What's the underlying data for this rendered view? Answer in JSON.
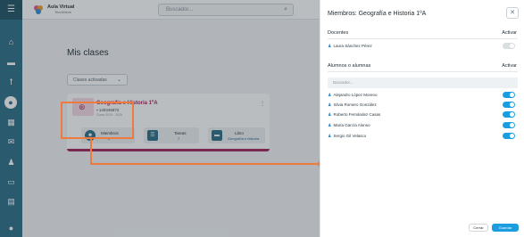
{
  "app": {
    "brand": "Aula Virtual",
    "brand_sub": "TecniMeve"
  },
  "topbar": {
    "search_placeholder": "Buscador...",
    "search_icon": "search-icon"
  },
  "nav": {
    "icons": [
      "menu-icon",
      "home-icon",
      "book-icon",
      "translate-icon",
      "user-circle-icon",
      "calendar-icon",
      "mail-icon",
      "person-icon",
      "folder-icon",
      "document-icon",
      "info-icon"
    ]
  },
  "main": {
    "title": "Mis clases",
    "filter": "Clases activadas",
    "card": {
      "title": "Geografía e Historia 1ºA",
      "code": "140345872",
      "dates": "Curso 2024 · 2025",
      "tiles": [
        {
          "label": "Miembros",
          "value": "6"
        },
        {
          "label": "Tareas",
          "value": "7"
        },
        {
          "label": "Libro",
          "value": "Geografía e historia"
        }
      ]
    }
  },
  "panel": {
    "title": "Miembros: Geografía e Historia 1ºA",
    "docentes_heading": "Docentes",
    "activar_label": "Activar",
    "teachers": [
      {
        "name": "Laura Sánchez Pérez",
        "active": false
      }
    ],
    "alumnos_heading": "Alumnos o alumnas",
    "search_placeholder": "Buscador...",
    "students": [
      {
        "name": "Alejandro López Moreno",
        "active": true
      },
      {
        "name": "Silvia Romero González",
        "active": true
      },
      {
        "name": "Roberto Fernández Casas",
        "active": true
      },
      {
        "name": "María García Alonso",
        "active": true
      },
      {
        "name": "Sergio Gil Velasco",
        "active": true
      }
    ],
    "cancel_label": "Cerrar",
    "save_label": "Guardar"
  },
  "colors": {
    "accent": "#1b9ee0",
    "nav": "#2c6d86",
    "class": "#a3245a",
    "annotation": "#ee7a3e"
  }
}
